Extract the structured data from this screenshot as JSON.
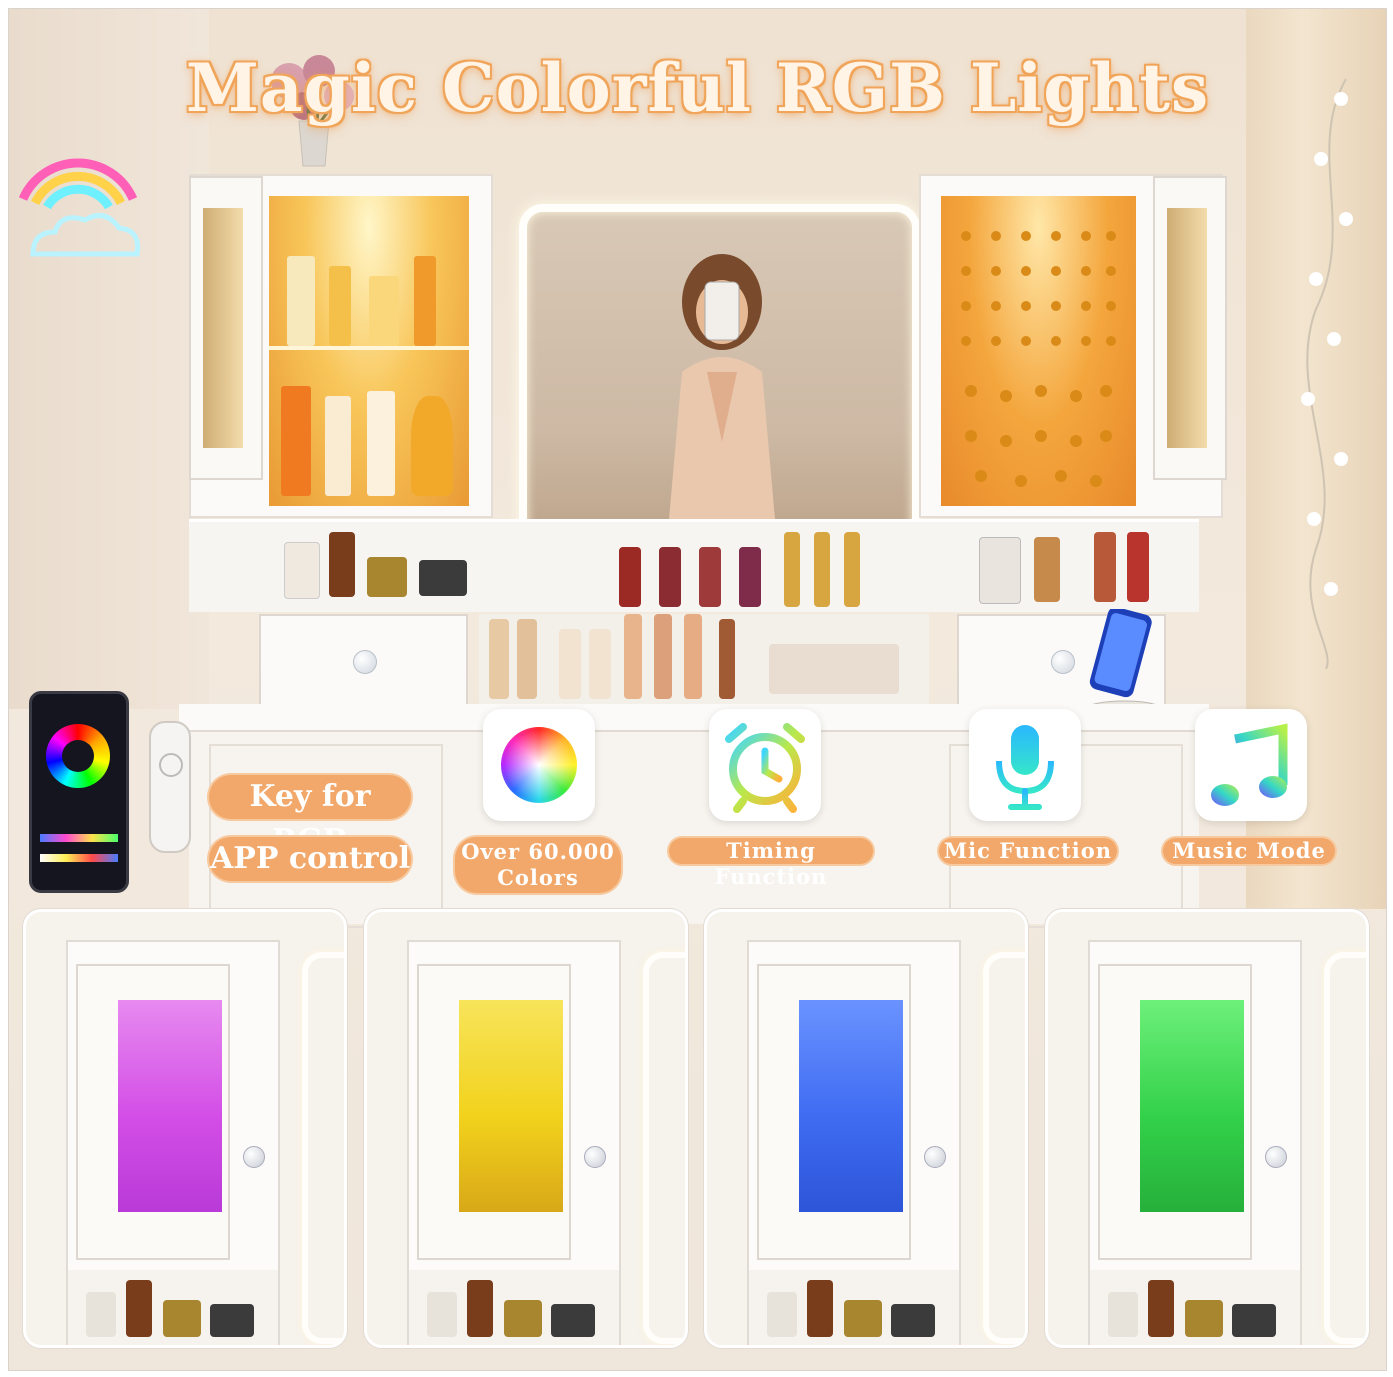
{
  "title": "Magic Colorful RGB Lights",
  "control_labels": {
    "key_rgb": "Key for RGB",
    "app_control": "APP control"
  },
  "features": [
    {
      "label": "Over 60.000 Colors",
      "icon": "color-wheel-icon"
    },
    {
      "label": "Timing Function",
      "icon": "alarm-clock-icon"
    },
    {
      "label": "Mic Function",
      "icon": "microphone-icon"
    },
    {
      "label": "Music Mode",
      "icon": "music-note-icon"
    }
  ],
  "panels": [
    {
      "name": "purple",
      "color": "#d34ee6"
    },
    {
      "name": "yellow",
      "color": "#f2d21c"
    },
    {
      "name": "blue",
      "color": "#3f6cf2"
    },
    {
      "name": "green",
      "color": "#33d14a"
    }
  ],
  "colors": {
    "accent": "#f1a86a",
    "title_glow": "#f0a55a",
    "warm_light": "#f8c65a"
  }
}
